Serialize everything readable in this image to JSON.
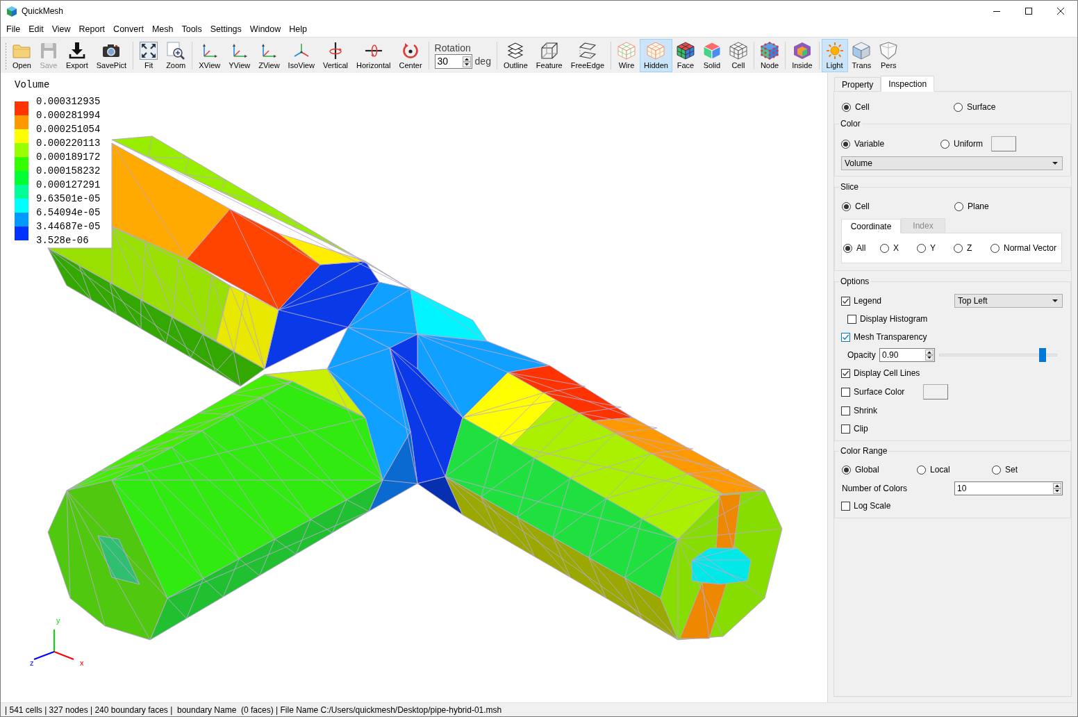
{
  "window": {
    "title": "QuickMesh"
  },
  "menu": [
    "File",
    "Edit",
    "View",
    "Report",
    "Convert",
    "Mesh",
    "Tools",
    "Settings",
    "Window",
    "Help"
  ],
  "toolbar": [
    {
      "kind": "buttons",
      "items": [
        {
          "label": "Open",
          "selected": false,
          "disabled": false
        },
        {
          "label": "Save",
          "selected": false,
          "disabled": true
        },
        {
          "label": "Export",
          "selected": false,
          "disabled": false
        },
        {
          "label": "SavePict",
          "selected": false,
          "disabled": false
        }
      ]
    },
    {
      "kind": "buttons",
      "items": [
        {
          "label": "Fit",
          "selected": false,
          "disabled": false
        },
        {
          "label": "Zoom",
          "selected": false,
          "disabled": false
        }
      ]
    },
    {
      "kind": "buttons",
      "items": [
        {
          "label": "XView",
          "selected": false,
          "disabled": false
        },
        {
          "label": "YView",
          "selected": false,
          "disabled": false
        },
        {
          "label": "ZView",
          "selected": false,
          "disabled": false
        },
        {
          "label": "IsoView",
          "selected": false,
          "disabled": false
        },
        {
          "label": "Vertical",
          "selected": false,
          "disabled": false
        },
        {
          "label": "Horizontal",
          "selected": false,
          "disabled": false
        },
        {
          "label": "Center",
          "selected": false,
          "disabled": false
        }
      ]
    },
    {
      "kind": "spin",
      "label": "Rotation",
      "value": "30",
      "unit": "deg"
    },
    {
      "kind": "buttons",
      "items": [
        {
          "label": "Outline",
          "selected": false,
          "disabled": false
        },
        {
          "label": "Feature",
          "selected": false,
          "disabled": false
        },
        {
          "label": "FreeEdge",
          "selected": false,
          "disabled": false
        }
      ]
    },
    {
      "kind": "buttons",
      "items": [
        {
          "label": "Wire",
          "selected": false,
          "disabled": false
        },
        {
          "label": "Hidden",
          "selected": true,
          "disabled": false
        },
        {
          "label": "Face",
          "selected": false,
          "disabled": false
        },
        {
          "label": "Solid",
          "selected": false,
          "disabled": false
        },
        {
          "label": "Cell",
          "selected": false,
          "disabled": false
        }
      ]
    },
    {
      "kind": "buttons",
      "items": [
        {
          "label": "Node",
          "selected": false,
          "disabled": false
        }
      ]
    },
    {
      "kind": "buttons",
      "items": [
        {
          "label": "Inside",
          "selected": false,
          "disabled": false
        }
      ]
    },
    {
      "kind": "buttons",
      "items": [
        {
          "label": "Light",
          "selected": true,
          "disabled": false
        },
        {
          "label": "Trans",
          "selected": false,
          "disabled": false
        },
        {
          "label": "Pers",
          "selected": false,
          "disabled": false
        }
      ]
    }
  ],
  "viewport": {
    "legend": {
      "title": "Volume",
      "swatches": [
        {
          "color": "#ff3300"
        },
        {
          "color": "#ff9900"
        },
        {
          "color": "#ffff00"
        },
        {
          "color": "#99ff00"
        },
        {
          "color": "#33ff00"
        },
        {
          "color": "#00ff33"
        },
        {
          "color": "#00ff99"
        },
        {
          "color": "#00ffff"
        },
        {
          "color": "#0099ff"
        },
        {
          "color": "#0033ff"
        }
      ],
      "labels": [
        "0.000312935",
        "0.000281994",
        "0.000251054",
        "0.000220113",
        "0.000189172",
        "0.000158232",
        "0.000127291",
        "9.63501e-05",
        "6.54094e-05",
        "3.44687e-05",
        "3.528e-06"
      ]
    },
    "axes": [
      {
        "label": "y",
        "color": "#00dd00"
      },
      {
        "label": "z",
        "color": "#0000ff"
      },
      {
        "label": "x",
        "color": "#ff0000"
      }
    ]
  },
  "panel": {
    "tabs": [
      {
        "label": "Property",
        "selected": false
      },
      {
        "label": "Inspection",
        "selected": true
      }
    ],
    "target": [
      {
        "label": "Cell",
        "selected": true
      },
      {
        "label": "Surface",
        "selected": false
      }
    ],
    "color": {
      "title": "Color",
      "modes": [
        {
          "label": "Variable",
          "selected": true
        },
        {
          "label": "Uniform",
          "selected": false
        }
      ],
      "variable": "Volume"
    },
    "slice": {
      "title": "Slice",
      "modes": [
        {
          "label": "Cell",
          "selected": true
        },
        {
          "label": "Plane",
          "selected": false
        }
      ],
      "tabs": [
        {
          "label": "Coordinate",
          "selected": true
        },
        {
          "label": "Index",
          "selected": false
        }
      ],
      "directions": [
        {
          "label": "All",
          "selected": true
        },
        {
          "label": "X",
          "selected": false
        },
        {
          "label": "Y",
          "selected": false
        },
        {
          "label": "Z",
          "selected": false
        },
        {
          "label": "Normal Vector",
          "selected": false
        }
      ]
    },
    "options": {
      "title": "Options",
      "items": [
        {
          "kind": "check-select",
          "label": "Legend",
          "checked": true,
          "focused": false,
          "value": "Top Left",
          "children": [
            {
              "kind": "check",
              "label": "Display Histogram",
              "checked": false,
              "focused": false
            }
          ]
        },
        {
          "kind": "check",
          "label": "Mesh Transparency",
          "checked": true,
          "focused": true,
          "children": [
            {
              "kind": "opacity",
              "label": "Opacity",
              "value": "0.90",
              "level": 0.9
            }
          ]
        },
        {
          "kind": "check",
          "label": "Display Cell Lines",
          "checked": true,
          "focused": false
        },
        {
          "kind": "check-color",
          "label": "Surface Color",
          "checked": false,
          "focused": false
        },
        {
          "kind": "check",
          "label": "Shrink",
          "checked": false,
          "focused": false
        },
        {
          "kind": "check",
          "label": "Clip",
          "checked": false,
          "focused": false
        }
      ]
    },
    "color_range": {
      "title": "Color Range",
      "modes": [
        {
          "label": "Global",
          "selected": true
        },
        {
          "label": "Local",
          "selected": false
        },
        {
          "label": "Set",
          "selected": false
        }
      ],
      "count": {
        "label": "Number of Colors",
        "value": "10"
      },
      "log_scale": {
        "label": "Log Scale",
        "checked": false,
        "focused": false
      }
    }
  },
  "status_bar": "| 541 cells | 327 nodes | 240 boundary faces |  boundary Name  (0 faces) | File Name C:/Users/quickmesh/Desktop/pipe-hybrid-01.msh"
}
